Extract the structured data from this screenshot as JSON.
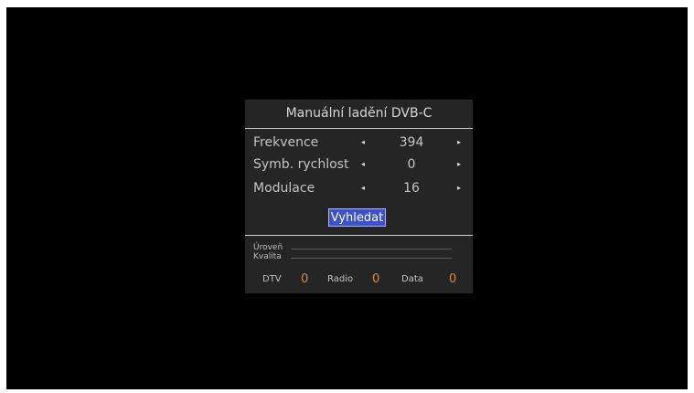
{
  "dialog": {
    "title": "Manuální ladění DVB-C",
    "rows": [
      {
        "label": "Frekvence",
        "value": "394",
        "left_arrow": "◂",
        "right_arrow": "▸"
      },
      {
        "label": "Symb. rychlost",
        "value": "0",
        "left_arrow": "◂",
        "right_arrow": "▸"
      },
      {
        "label": "Modulace",
        "value": "16",
        "left_arrow": "◂",
        "right_arrow": "▸"
      }
    ],
    "search_button": "Vyhledat",
    "meters": {
      "level_label": "Úroveň",
      "quality_label": "Kvalita",
      "level_value": 0,
      "quality_value": 0
    },
    "stats": {
      "dtv_label": "DTV",
      "dtv_count": "0",
      "radio_label": "Radio",
      "radio_count": "0",
      "data_label": "Data",
      "data_count": "0"
    }
  },
  "colors": {
    "screen_background": "#000000",
    "dialog_background": "#252525",
    "button_fill": "#3f51c9",
    "count_accent": "#e08a3c"
  },
  "icons": {
    "left_arrow": "arrow-left-icon",
    "right_arrow": "arrow-right-icon"
  }
}
